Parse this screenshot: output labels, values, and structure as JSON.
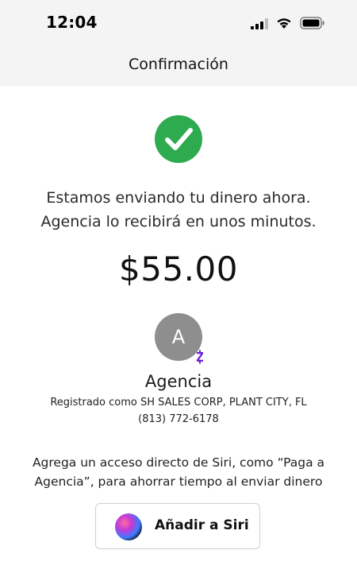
{
  "status_bar": {
    "time": "12:04",
    "icons": [
      "cellular-signal-icon",
      "wifi-icon",
      "battery-icon"
    ]
  },
  "nav": {
    "title": "Confirmación"
  },
  "confirmation": {
    "icon": "check-circle-icon",
    "accent_color": "#2eaa4f",
    "message_line1": "Estamos enviando tu dinero ahora.",
    "message_line2": "Agencia lo recibirá en unos minutos.",
    "amount": "$55.00"
  },
  "recipient": {
    "initial": "A",
    "badge_icon": "zelle-icon",
    "badge_color": "#6d1ed4",
    "name": "Agencia",
    "registration": "Registrado como SH SALES CORP, PLANT CITY, FL",
    "phone": "(813) 772-6178"
  },
  "siri": {
    "prompt_line1": "Agrega un acceso directo de Siri, como “Paga a",
    "prompt_line2": "Agencia”, para ahorrar tiempo al enviar dinero",
    "button_icon": "siri-icon",
    "button_label": "Añadir a Siri"
  }
}
